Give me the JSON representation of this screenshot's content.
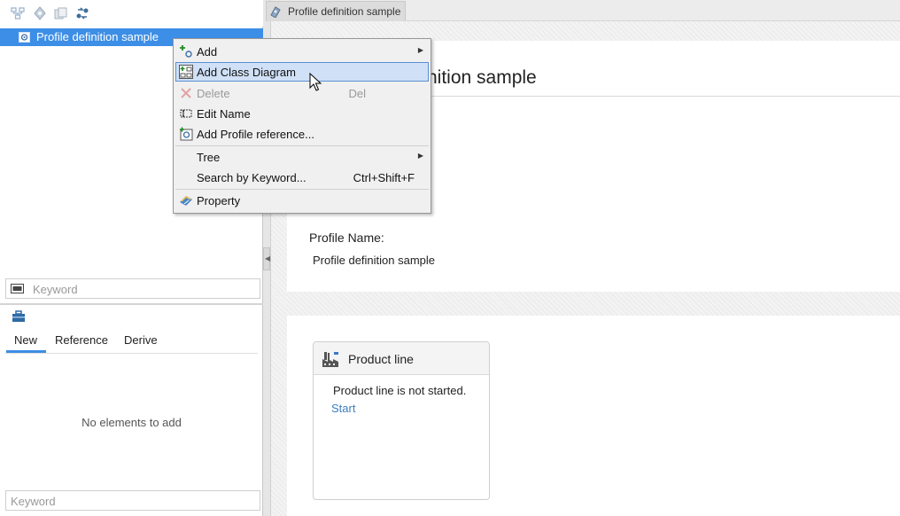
{
  "left_pane": {
    "toolbar": {
      "icons": [
        "diagram-layout-icon",
        "profile-icon",
        "documents-icon",
        "link-icon"
      ]
    },
    "tree": {
      "selected_item": "Profile definition sample"
    },
    "tree_search": {
      "placeholder": "Keyword"
    },
    "palette": {
      "toolbox_icon": "toolbox-icon",
      "tabs": [
        {
          "label": "New"
        },
        {
          "label": "Reference"
        },
        {
          "label": "Derive"
        }
      ],
      "empty_message": "No elements to add",
      "search": {
        "placeholder": "Keyword"
      }
    }
  },
  "context_menu": {
    "items": [
      {
        "label": "Add",
        "has_submenu": true
      },
      {
        "label": "Add Class Diagram",
        "highlighted": true
      },
      {
        "label": "Delete",
        "shortcut": "Del",
        "disabled": true
      },
      {
        "label": "Edit Name"
      },
      {
        "label": "Add Profile reference..."
      },
      {
        "label": "Tree",
        "has_submenu": true
      },
      {
        "label": "Search by Keyword...",
        "shortcut": "Ctrl+Shift+F"
      },
      {
        "label": "Property"
      }
    ]
  },
  "editor": {
    "tab_label": "Profile definition sample",
    "title_visible": "nition sample",
    "field_label": "Profile Name:",
    "field_value": "Profile definition sample",
    "product_line": {
      "title": "Product line",
      "message": "Product line is not started.",
      "action": "Start"
    }
  },
  "colors": {
    "selection": "#3d8ee6",
    "menu_highlight": "#cfe0f7",
    "link": "#3b7fc4"
  }
}
